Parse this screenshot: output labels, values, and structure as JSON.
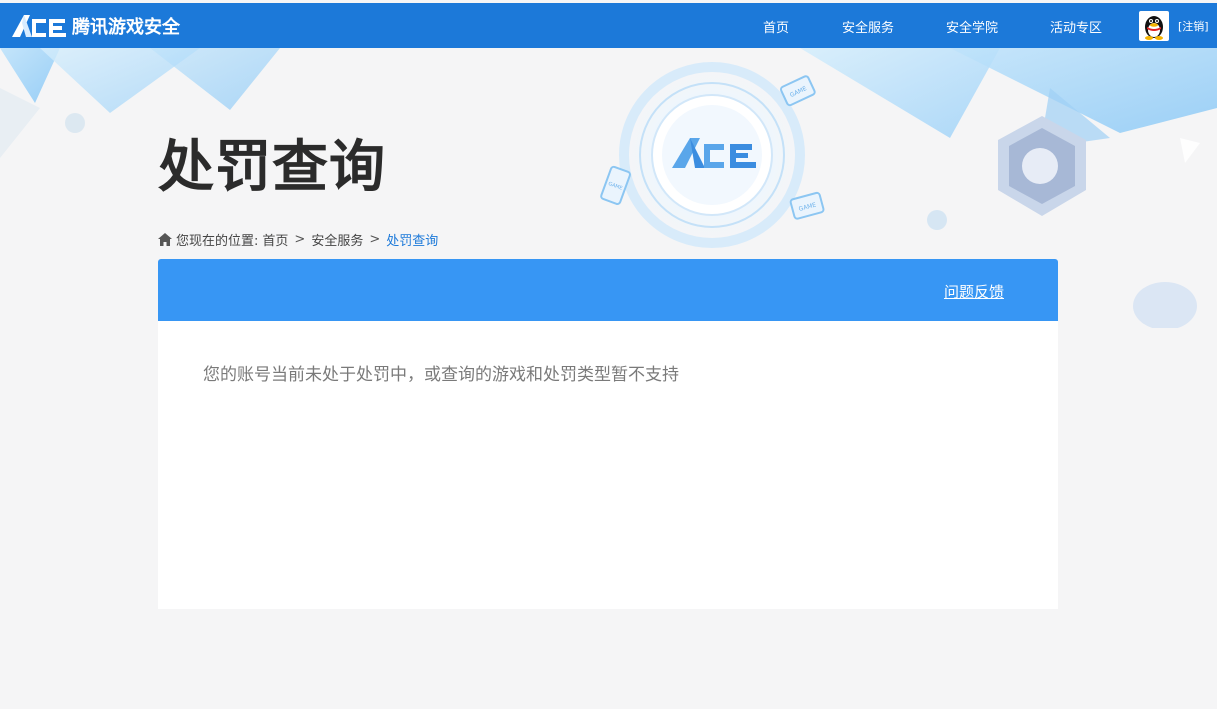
{
  "header": {
    "logo_text": "腾讯游戏安全",
    "nav": [
      "首页",
      "安全服务",
      "安全学院",
      "活动专区"
    ],
    "logout_label": "[注销]"
  },
  "banner": {
    "page_title": "处罚查询",
    "ace_badge_text": "ACE",
    "game_tag": "GAME"
  },
  "breadcrumb": {
    "prefix": "您现在的位置:",
    "items": [
      "首页",
      "安全服务",
      "处罚查询"
    ],
    "separator": ">"
  },
  "card": {
    "feedback_label": "问题反馈",
    "message": "您的账号当前未处于处罚中，或查询的游戏和处罚类型暂不支持"
  },
  "colors": {
    "topbar": "#1c79d9",
    "card_header": "#3796f4",
    "accent_link": "#1c79d9"
  }
}
